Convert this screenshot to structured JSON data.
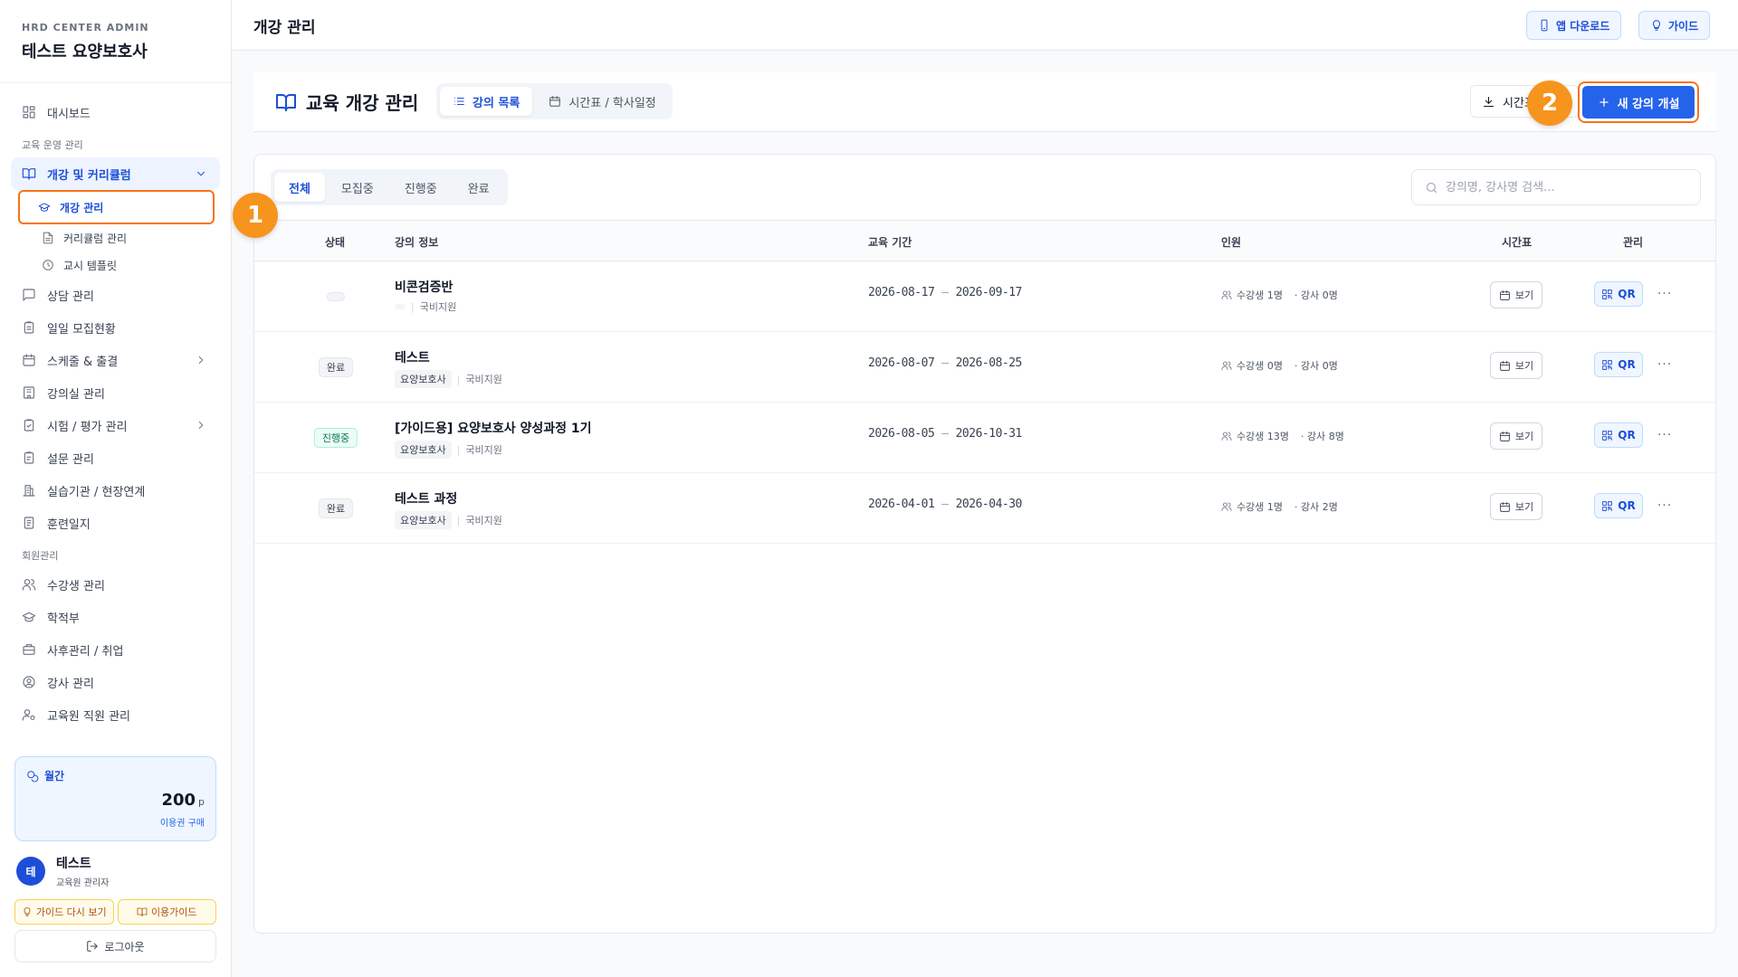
{
  "brand": {
    "subtitle": "HRD CENTER ADMIN",
    "title": "테스트 요양보호사"
  },
  "sidebar": {
    "dashboard": "대시보드",
    "section_ops": "교육 운영 관리",
    "curriculum_group": "개강 및 커리큘럼",
    "sub_items": [
      "개강 관리",
      "커리큘럼 관리",
      "교시 템플릿"
    ],
    "ops_items": [
      "상담 관리",
      "일일 모집현황",
      "스케줄 & 출결",
      "강의실 관리",
      "시험 / 평가 관리",
      "설문 관리",
      "실습기관 / 현장연계",
      "훈련일지"
    ],
    "section_members": "회원관리",
    "member_items": [
      "수강생 관리",
      "학적부",
      "사후관리 / 취업",
      "강사 관리",
      "교육원 직원 관리"
    ]
  },
  "plan": {
    "label": "월간",
    "value": "200",
    "unit": "p",
    "link": "이용권 구매"
  },
  "user": {
    "initial": "테",
    "name": "테스트",
    "role": "교육원 관리자"
  },
  "guide": {
    "replay": "가이드 다시 보기",
    "usage": "이용가이드",
    "logout": "로그아웃"
  },
  "topbar": {
    "title": "개강 관리",
    "app_download": "앱 다운로드",
    "guide": "가이드"
  },
  "header": {
    "title": "교육 개강 관리",
    "tabs": [
      "강의 목록",
      "시간표 / 학사일정"
    ],
    "export": "시간표",
    "new_course": "새 강의 개설"
  },
  "markers": [
    "1",
    "2"
  ],
  "filters": [
    "전체",
    "모집중",
    "진행중",
    "완료"
  ],
  "search": {
    "placeholder": "강의명, 강사명 검색..."
  },
  "table": {
    "columns": [
      "상태",
      "강의 정보",
      "교육 기간",
      "인원",
      "시간표",
      "관리"
    ],
    "view_label": "보기",
    "qr_label": "QR",
    "rows": [
      {
        "status": "",
        "title": "비콘검증반",
        "category": "",
        "funding": "국비지원",
        "start": "2026-08-17",
        "end": "2026-09-17",
        "students": "수강생 1명",
        "instructors": "· 강사 0명"
      },
      {
        "status": "완료",
        "title": "테스트",
        "category": "요양보호사",
        "funding": "국비지원",
        "start": "2026-08-07",
        "end": "2026-08-25",
        "students": "수강생 0명",
        "instructors": "· 강사 0명"
      },
      {
        "status": "진행중",
        "title": "[가이드용] 요양보호사 양성과정 1기",
        "category": "요양보호사",
        "funding": "국비지원",
        "start": "2026-08-05",
        "end": "2026-10-31",
        "students": "수강생 13명",
        "instructors": "· 강사 8명"
      },
      {
        "status": "완료",
        "title": "테스트 과정",
        "category": "요양보호사",
        "funding": "국비지원",
        "start": "2026-04-01",
        "end": "2026-04-30",
        "students": "수강생 1명",
        "instructors": "· 강사 2명"
      }
    ]
  }
}
